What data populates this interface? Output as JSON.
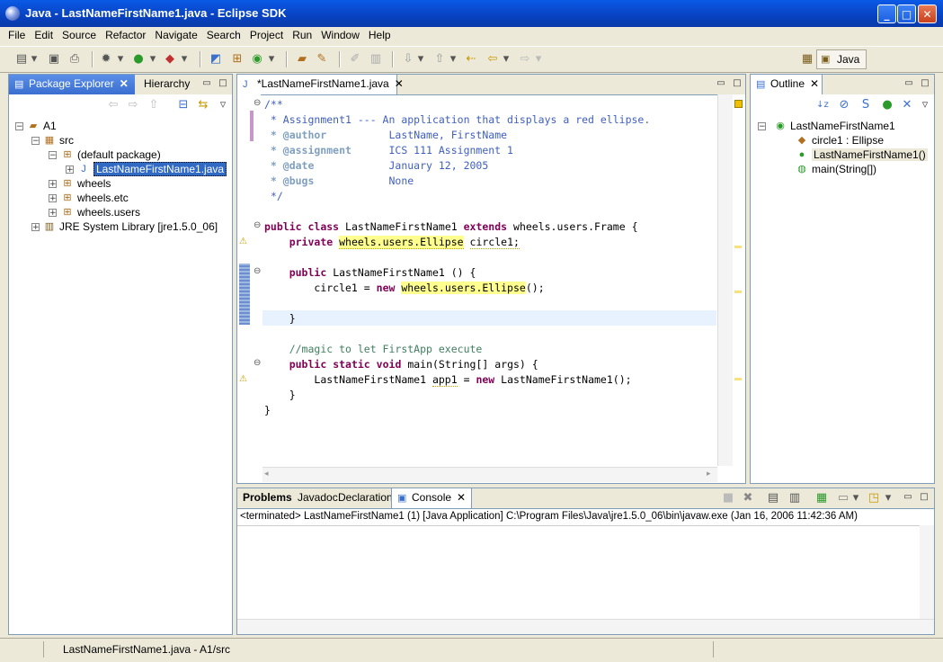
{
  "window": {
    "title": "Java - LastNameFirstName1.java - Eclipse SDK"
  },
  "menu": [
    "File",
    "Edit",
    "Source",
    "Refactor",
    "Navigate",
    "Search",
    "Project",
    "Run",
    "Window",
    "Help"
  ],
  "perspective": {
    "label": "Java"
  },
  "package_explorer": {
    "tabs": [
      "Package Explorer",
      "Hierarchy"
    ],
    "tree": [
      {
        "label": "A1"
      },
      {
        "label": "src"
      },
      {
        "label": "(default package)"
      },
      {
        "label": "LastNameFirstName1.java"
      },
      {
        "label": "wheels"
      },
      {
        "label": "wheels.etc"
      },
      {
        "label": "wheels.users"
      },
      {
        "label": "JRE System Library [jre1.5.0_06]"
      }
    ]
  },
  "editor": {
    "tab": "*LastNameFirstName1.java",
    "lines": [
      "/**",
      " * @author",
      " * @assignment",
      " * @date",
      " * @bugs"
    ],
    "doc": {
      "desc": "Assignment1 --- An application that displays a red ellipse.",
      "author": "LastName, FirstName",
      "assignment": "ICS 111 Assignment 1",
      "date": "January 12, 2005",
      "bugs": "None",
      "end": " */"
    },
    "code": {
      "kw_public": "public",
      "kw_class": "class",
      "class_name": "LastNameFirstName1",
      "kw_extends": "extends",
      "superclass": "wheels.users.Frame {",
      "kw_private": "private",
      "ellipse_type": "wheels.users.Ellipse",
      "field": "circle1;",
      "ctor": "LastNameFirstName1 () {",
      "assign": "circle1 = ",
      "kw_new": "new",
      "ctor_call": "();",
      "close1": "}",
      "comment": "//magic to let FirstApp execute",
      "kw_static": "static",
      "kw_void": "void",
      "main_sig": "main(String[] args) {",
      "app_decl_a": "LastNameFirstName1 ",
      "app_var": "app1",
      "app_decl_b": " = ",
      "app_ctor": "LastNameFirstName1();",
      "close2": "}",
      "close3": "}"
    }
  },
  "outline": {
    "tab": "Outline",
    "items": [
      {
        "label": "LastNameFirstName1"
      },
      {
        "label": "circle1 : Ellipse"
      },
      {
        "label": "LastNameFirstName1()"
      },
      {
        "label": "main(String[])"
      }
    ]
  },
  "bottom": {
    "tabs": [
      "Problems",
      "Javadoc",
      "Declaration",
      "Console"
    ],
    "console_header": "<terminated> LastNameFirstName1 (1) [Java Application] C:\\Program Files\\Java\\jre1.5.0_06\\bin\\javaw.exe (Jan 16, 2006 11:42:36 AM)"
  },
  "status": {
    "text": "LastNameFirstName1.java - A1/src"
  },
  "colors": {
    "title_blue": "#0842c0",
    "selection": "#316ac5",
    "keyword": "#7f0055",
    "comment": "#3f5fbf",
    "line_comment": "#3f7f5f"
  }
}
